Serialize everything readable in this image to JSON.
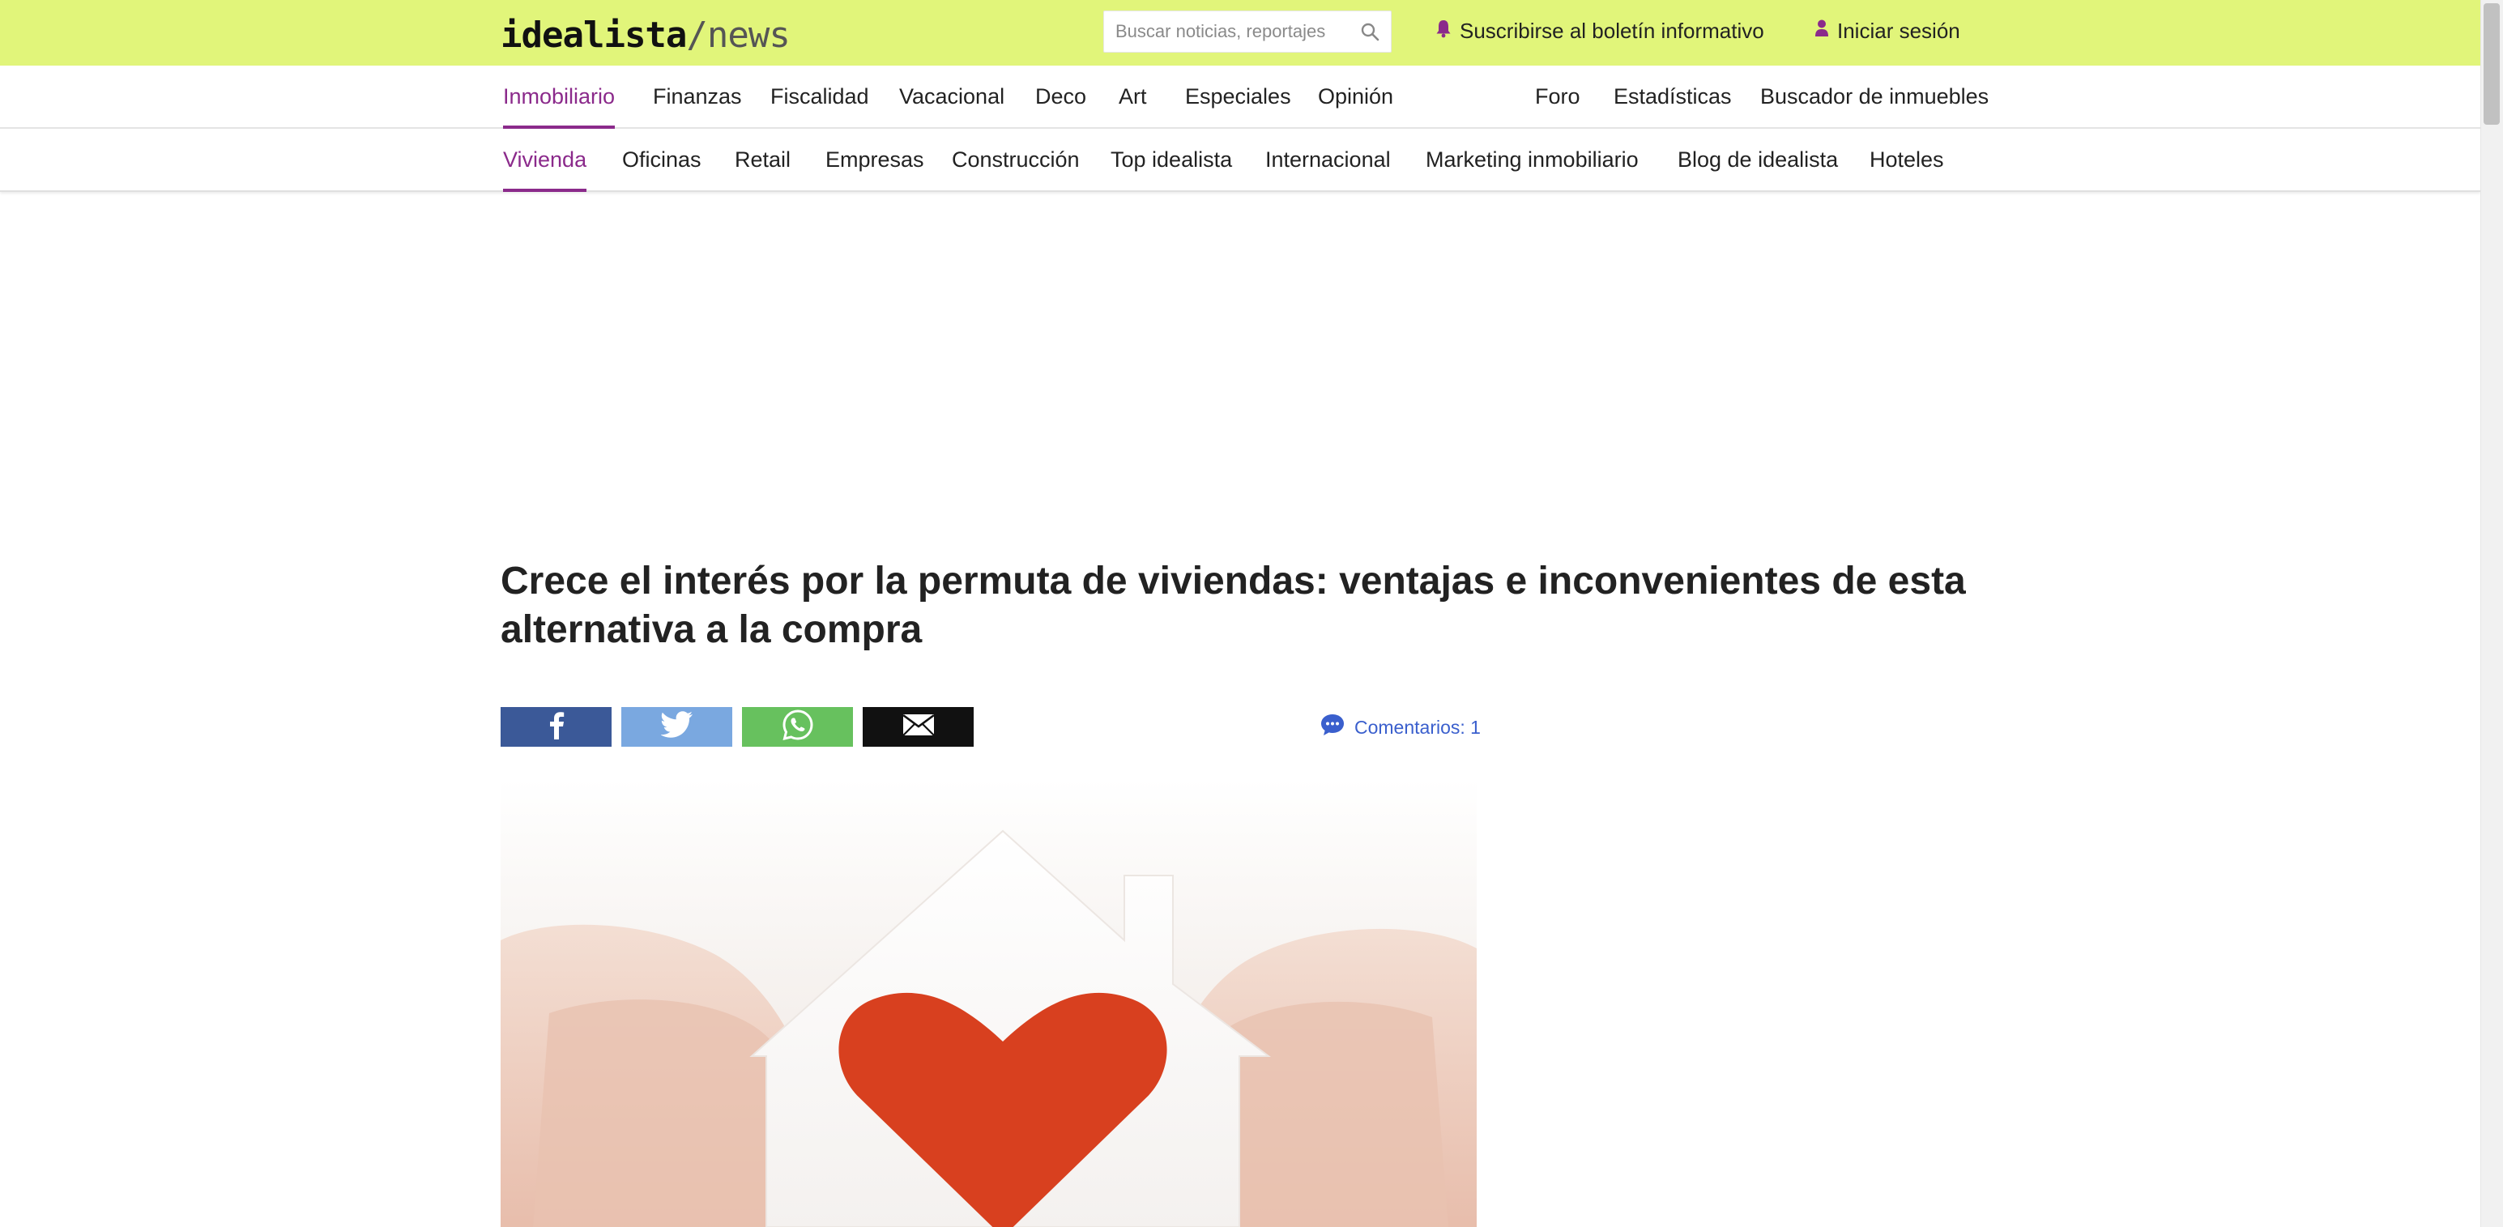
{
  "header": {
    "logo_main": "idealista",
    "logo_sub": "/news",
    "search_placeholder": "Buscar noticias, reportajes",
    "newsletter_label": "Suscribirse al boletín informativo",
    "login_label": "Iniciar sesión",
    "bar_color": "#e1f57a",
    "accent_color": "#8b2a8b"
  },
  "nav_primary": {
    "items": [
      "Inmobiliario",
      "Finanzas",
      "Fiscalidad",
      "Vacacional",
      "Deco",
      "Art",
      "Especiales",
      "Opinión"
    ],
    "active": "Inmobiliario",
    "right_items": [
      "Foro",
      "Estadísticas",
      "Buscador de inmuebles"
    ]
  },
  "nav_secondary": {
    "items": [
      "Vivienda",
      "Oficinas",
      "Retail",
      "Empresas",
      "Construcción",
      "Top idealista",
      "Internacional",
      "Marketing inmobiliario",
      "Blog de idealista",
      "Hoteles"
    ],
    "active": "Vivienda"
  },
  "article": {
    "title": "Crece el interés por la permuta de viviendas: ventajas e inconvenientes de esta alternativa a la compra",
    "comments_label": "Comentarios: 1",
    "share_buttons": [
      {
        "icon": "facebook-icon",
        "color": "#3b5998"
      },
      {
        "icon": "twitter-icon",
        "color": "#7aa8e0"
      },
      {
        "icon": "whatsapp-icon",
        "color": "#67c15e"
      },
      {
        "icon": "email-icon",
        "color": "#111111"
      }
    ],
    "image_alt": "Manos sosteniendo una casa blanca con un corazón rojo"
  }
}
